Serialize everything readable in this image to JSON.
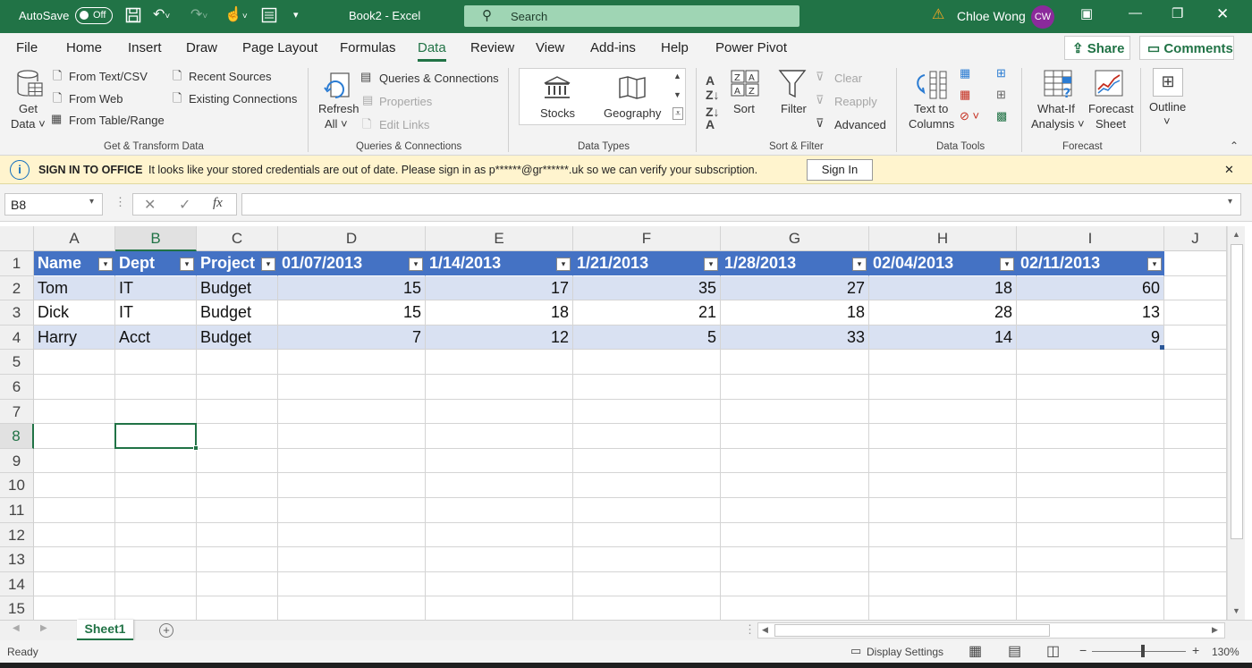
{
  "titlebar": {
    "autosave_label": "AutoSave",
    "autosave_state": "Off",
    "doc_title": "Book2 - Excel",
    "search_placeholder": "Search",
    "user_name": "Chloe Wong",
    "user_initials": "CW",
    "accent": "#217346",
    "icons": [
      "save-icon",
      "undo-icon",
      "redo-icon",
      "touch-mode-icon",
      "form-icon",
      "customize-qat-icon",
      "warning-icon",
      "ribbon-display-icon",
      "minimize-icon",
      "restore-icon",
      "close-icon"
    ]
  },
  "menu": {
    "tabs": [
      "File",
      "Home",
      "Insert",
      "Draw",
      "Page Layout",
      "Formulas",
      "Data",
      "Review",
      "View",
      "Add-ins",
      "Help",
      "Power Pivot"
    ],
    "active_tab": "Data",
    "share_label": "Share",
    "comments_label": "Comments"
  },
  "ribbon": {
    "get_data": {
      "line1": "Get",
      "line2": "Data ˅"
    },
    "from_text_csv": "From Text/CSV",
    "from_web": "From Web",
    "from_table_range": "From Table/Range",
    "recent_sources": "Recent Sources",
    "existing_connections": "Existing Connections",
    "group_get_transform": "Get & Transform Data",
    "refresh_all": {
      "line1": "Refresh",
      "line2": "All ˅"
    },
    "queries_connections": "Queries & Connections",
    "properties": "Properties",
    "edit_links": "Edit Links",
    "group_queries": "Queries & Connections",
    "stocks": "Stocks",
    "geography": "Geography",
    "group_data_types": "Data Types",
    "sort": "Sort",
    "filter": "Filter",
    "clear": "Clear",
    "reapply": "Reapply",
    "advanced": "Advanced",
    "group_sort_filter": "Sort & Filter",
    "text_to_columns": {
      "line1": "Text to",
      "line2": "Columns"
    },
    "group_data_tools": "Data Tools",
    "what_if": {
      "line1": "What-If",
      "line2": "Analysis ˅"
    },
    "forecast_sheet": {
      "line1": "Forecast",
      "line2": "Sheet"
    },
    "group_forecast": "Forecast",
    "outline": {
      "line1": "Outline",
      "line2": "˅"
    }
  },
  "signin_bar": {
    "title": "SIGN IN TO OFFICE",
    "message": "It looks like your stored credentials are out of date. Please sign in as p******@gr******.uk so we can verify your subscription.",
    "button": "Sign In",
    "close": "✕"
  },
  "formula_bar": {
    "name_box": "B8",
    "fx": "fx",
    "formula": ""
  },
  "sheet": {
    "columns": [
      "A",
      "B",
      "C",
      "D",
      "E",
      "F",
      "G",
      "H",
      "I",
      "J"
    ],
    "selected_column": "B",
    "rows": [
      "1",
      "2",
      "3",
      "4",
      "5",
      "6",
      "7",
      "8",
      "9",
      "10",
      "11",
      "12",
      "13",
      "14",
      "15"
    ],
    "selected_row": "8",
    "table_header": [
      "Name",
      "Dept",
      "Project",
      "01/07/2013",
      "1/14/2013",
      "1/21/2013",
      "1/28/2013",
      "02/04/2013",
      "02/11/2013"
    ],
    "table_rows": [
      [
        "Tom",
        "IT",
        "Budget",
        "15",
        "17",
        "35",
        "27",
        "18",
        "60"
      ],
      [
        "Dick",
        "IT",
        "Budget",
        "15",
        "18",
        "21",
        "18",
        "28",
        "13"
      ],
      [
        "Harry",
        "Acct",
        "Budget",
        "7",
        "12",
        "5",
        "33",
        "14",
        "9"
      ]
    ],
    "table_header_color": "#4472c4",
    "table_band_color": "#d9e1f2"
  },
  "sheet_tabs": {
    "active": "Sheet1"
  },
  "statusbar": {
    "ready": "Ready",
    "display_settings": "Display Settings",
    "zoom": "130%"
  }
}
